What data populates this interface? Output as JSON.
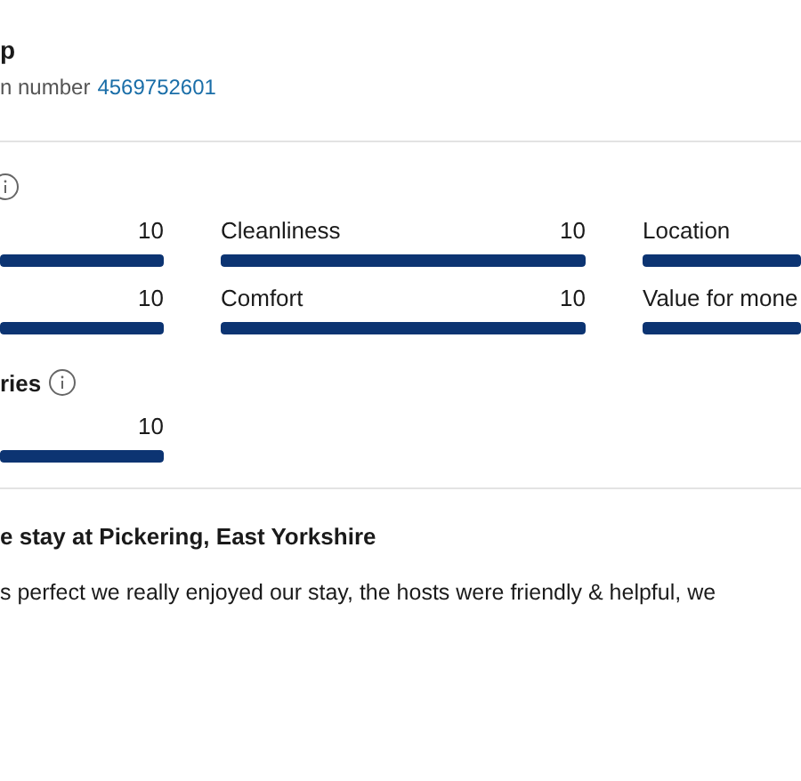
{
  "header": {
    "title": "p",
    "number_label": "n number",
    "number_link": "4569752601"
  },
  "ratings": {
    "items": [
      {
        "score": "10",
        "level": 1
      },
      {
        "label": "Cleanliness",
        "score": "10",
        "level": 1
      },
      {
        "label": "Location",
        "level": 1
      },
      {
        "score": "10",
        "level": 1
      },
      {
        "label": "Comfort",
        "score": "10",
        "level": 1
      },
      {
        "label": "Value for mone",
        "level": 1
      }
    ]
  },
  "other": {
    "title": "ries",
    "items": [
      {
        "score": "10",
        "level": 1
      }
    ]
  },
  "review": {
    "title": "e stay at Pickering, East Yorkshire",
    "text": "s perfect we really enjoyed our stay, the hosts were friendly & helpful, we"
  }
}
